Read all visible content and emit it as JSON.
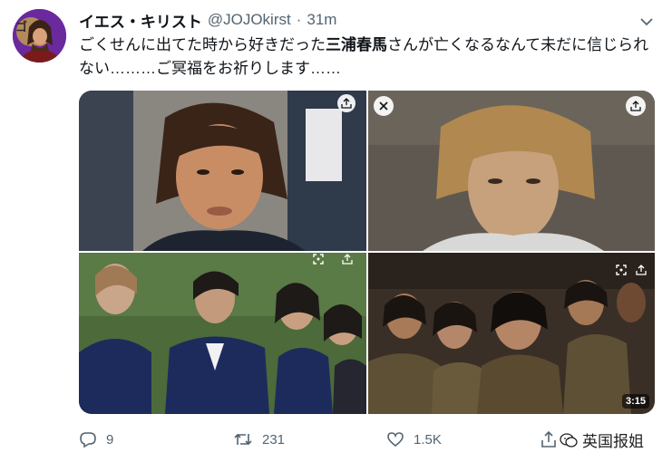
{
  "tweet": {
    "display_name": "イエス・キリスト",
    "handle": "@JOJOkirst",
    "separator": "·",
    "time": "31m",
    "text_before": "ごくせんに出てた時から好きだった",
    "text_bold": "三浦春馬",
    "text_after": "さんが亡くなるなんて未だに信じられない………ご冥福をお祈りします……"
  },
  "media": {
    "video_duration": "3:15"
  },
  "actions": {
    "reply_count": "9",
    "retweet_count": "231",
    "like_count": "1.5K"
  },
  "watermark": {
    "text": "英国报姐"
  }
}
